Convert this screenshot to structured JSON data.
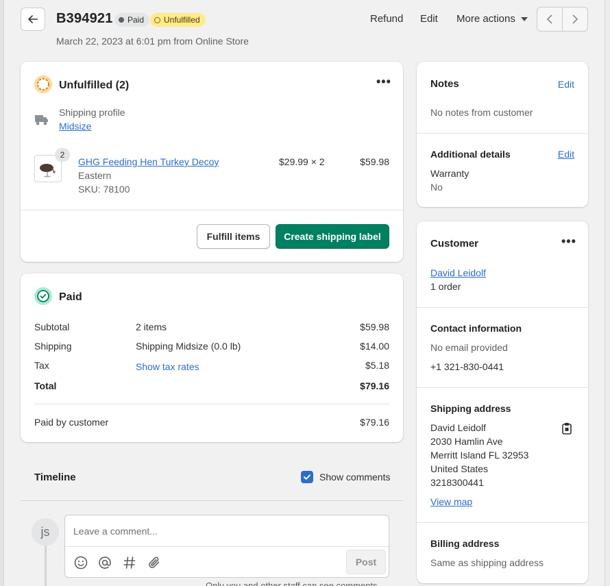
{
  "header": {
    "order_number": "B394921",
    "payment_badge": "Paid",
    "fulfillment_badge": "Unfulfilled",
    "subtitle": "March 22, 2023 at 6:01 pm from Online Store",
    "refund_label": "Refund",
    "edit_label": "Edit",
    "more_actions_label": "More actions"
  },
  "fulfillment": {
    "title": "Unfulfilled (2)",
    "shipping_profile_label": "Shipping profile",
    "shipping_profile_value": "Midsize",
    "item": {
      "quantity_badge": "2",
      "name": "GHG Feeding Hen Turkey Decoy",
      "variant": "Eastern",
      "sku": "SKU: 78100",
      "unit_price": "$29.99 × 2",
      "line_total": "$59.98"
    },
    "fulfill_button": "Fulfill items",
    "shipping_label_button": "Create shipping label"
  },
  "payment": {
    "title": "Paid",
    "rows": [
      {
        "label": "Subtotal",
        "detail": "2 items",
        "value": "$59.98"
      },
      {
        "label": "Shipping",
        "detail": "Shipping Midsize (0.0 lb)",
        "value": "$14.00"
      },
      {
        "label": "Tax",
        "detail": "Show tax rates",
        "value": "$5.18"
      }
    ],
    "total_label": "Total",
    "total_value": "$79.16",
    "paid_by_label": "Paid by customer",
    "paid_by_value": "$79.16"
  },
  "timeline": {
    "title": "Timeline",
    "show_comments_label": "Show comments",
    "show_comments_checked": true,
    "avatar_initials": "js",
    "comment_placeholder": "Leave a comment...",
    "post_label": "Post",
    "footer_note": "Only you and other staff can see comments"
  },
  "notes": {
    "title": "Notes",
    "edit_label": "Edit",
    "empty_text": "No notes from customer",
    "additional_title": "Additional details",
    "additional_edit_label": "Edit",
    "warranty_label": "Warranty",
    "warranty_value": "No"
  },
  "customer": {
    "title": "Customer",
    "name": "David Leidolf",
    "orders": "1 order",
    "contact_title": "Contact information",
    "email": "No email provided",
    "phone": "+1 321-830-0441",
    "shipping_title": "Shipping address",
    "shipping_lines": [
      "David Leidolf",
      "2030 Hamlin Ave",
      "Merritt Island FL 32953",
      "United States",
      "3218300441"
    ],
    "view_map_label": "View map",
    "billing_title": "Billing address",
    "billing_value": "Same as shipping address"
  },
  "colors": {
    "primary": "#008060",
    "link": "#2c6ecb",
    "unfulfilled_badge": "#ffea8a",
    "paid_badge": "#e4e5e7"
  }
}
